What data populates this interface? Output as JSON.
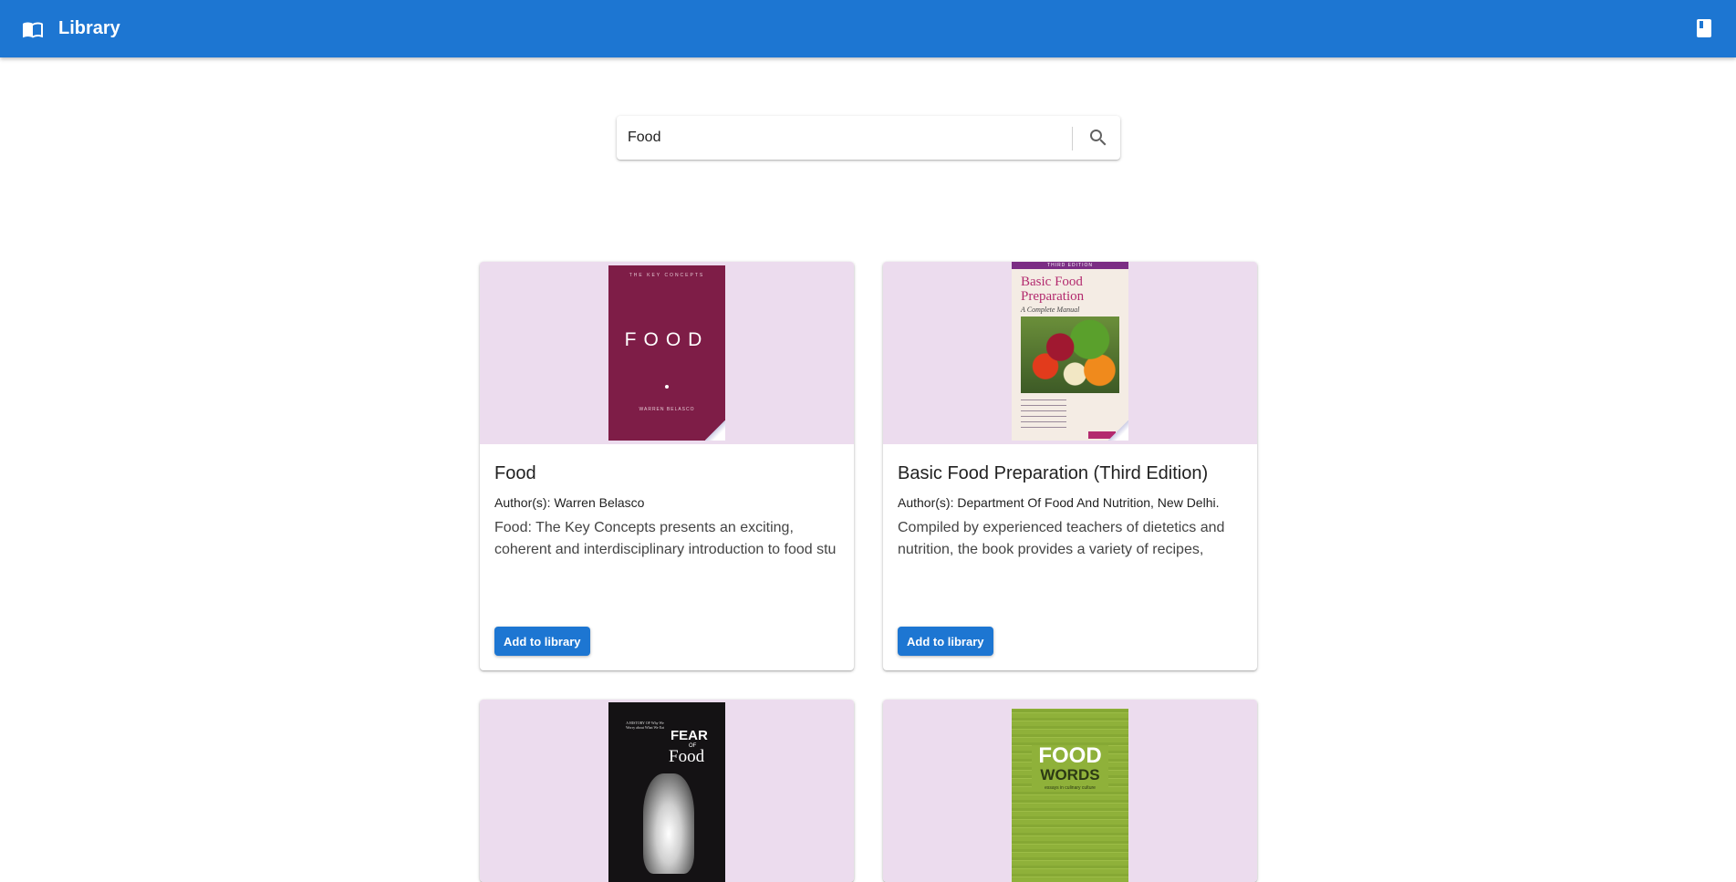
{
  "appbar": {
    "title": "Library",
    "icon": "book-open-icon",
    "right_icon": "book-icon"
  },
  "search": {
    "value": "Food",
    "icon": "search-icon"
  },
  "colors": {
    "primary": "#1d76d2",
    "media_background": "#ecdcee"
  },
  "books": [
    {
      "title": "Food",
      "authors": "Author(s): Warren Belasco",
      "description": "Food: The Key Concepts presents an exciting, coherent and interdisciplinary introduction to food stu",
      "button_label": "Add to library",
      "cover": {
        "top_text": "THE KEY CONCEPTS",
        "title_text": "FOOD",
        "author_text": "WARREN BELASCO"
      }
    },
    {
      "title": "Basic Food Preparation (Third Edition)",
      "authors": "Author(s): Department Of Food And Nutrition, New Delhi.",
      "description": "Compiled by experienced teachers of dietetics and nutrition, the book provides a variety of recipes,",
      "button_label": "Add to library",
      "cover": {
        "top_text": "THIRD EDITION",
        "title_text": "Basic Food Preparation",
        "subtitle_text": "A Complete Manual"
      }
    },
    {
      "cover": {
        "top_text": "A HISTORY OF Why We Worry about What We Eat",
        "title_line1": "FEAR",
        "title_line2": "OF",
        "title_line3": "Food"
      }
    },
    {
      "cover": {
        "title_line1": "FOOD",
        "title_line2": "WORDS",
        "subtitle_text": "essays in culinary culture"
      }
    }
  ]
}
